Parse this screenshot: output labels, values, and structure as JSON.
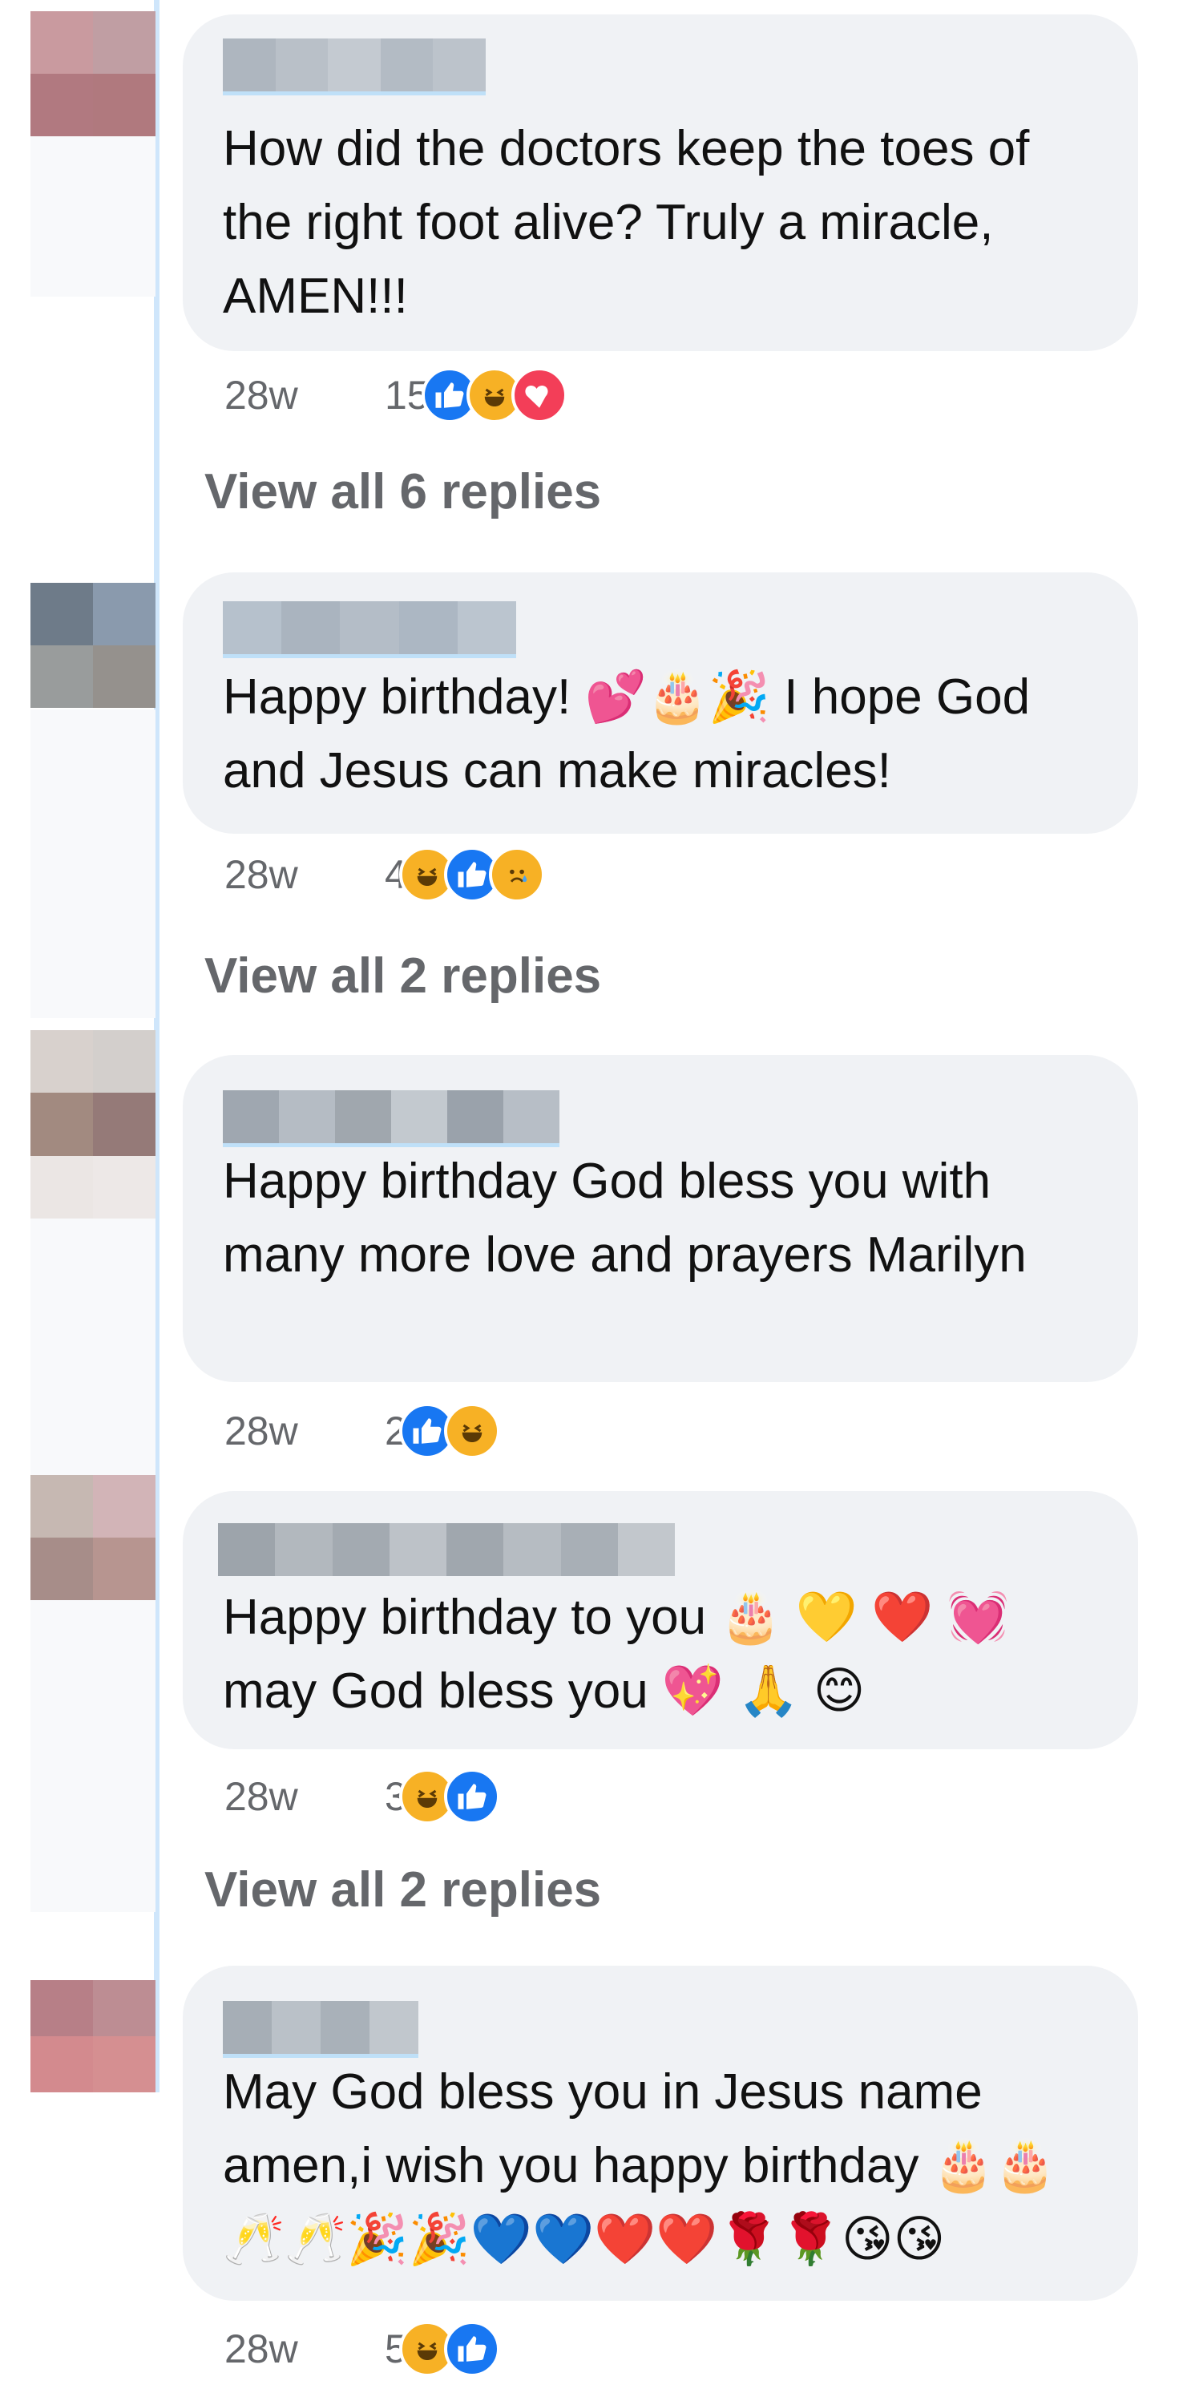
{
  "comments": [
    {
      "text": "How did the doctors keep the toes of the right foot alive? Truly a miracle, AMEN!!!",
      "time": "28w",
      "reaction_count": "15",
      "reactions": [
        "like-icon",
        "haha-icon",
        "love-icon"
      ],
      "view_replies": "View all 6 replies"
    },
    {
      "text": "Happy birthday! 💕🎂🎉 I hope God and Jesus can make miracles!",
      "time": "28w",
      "reaction_count": "4",
      "reactions": [
        "haha-icon",
        "like-icon",
        "sad-icon"
      ],
      "view_replies": "View all 2 replies"
    },
    {
      "text": "Happy birthday God bless you with many more love and prayers Marilyn",
      "time": "28w",
      "reaction_count": "2",
      "reactions": [
        "like-icon",
        "haha-icon"
      ]
    },
    {
      "text": "Happy birthday to you 🎂 💛 ❤️ 💓\nmay God bless you 💖 🙏 😊",
      "time": "28w",
      "reaction_count": "3",
      "reactions": [
        "haha-icon",
        "like-icon"
      ],
      "view_replies": "View all 2 replies"
    },
    {
      "text": "May God bless you in Jesus name amen,i wish you happy birthday 🎂🎂🥂🥂🎉🎉💙💙❤️❤️🌹🌹😘😘",
      "time": "28w",
      "reaction_count": "5",
      "reactions": [
        "haha-icon",
        "like-icon"
      ]
    }
  ],
  "colors": {
    "bubble": "#f0f2f5",
    "meta_text": "#65676b",
    "like": "#1877f2",
    "haha": "#f7b125",
    "love": "#f33e58",
    "thread_line": "#cfe6fb"
  }
}
